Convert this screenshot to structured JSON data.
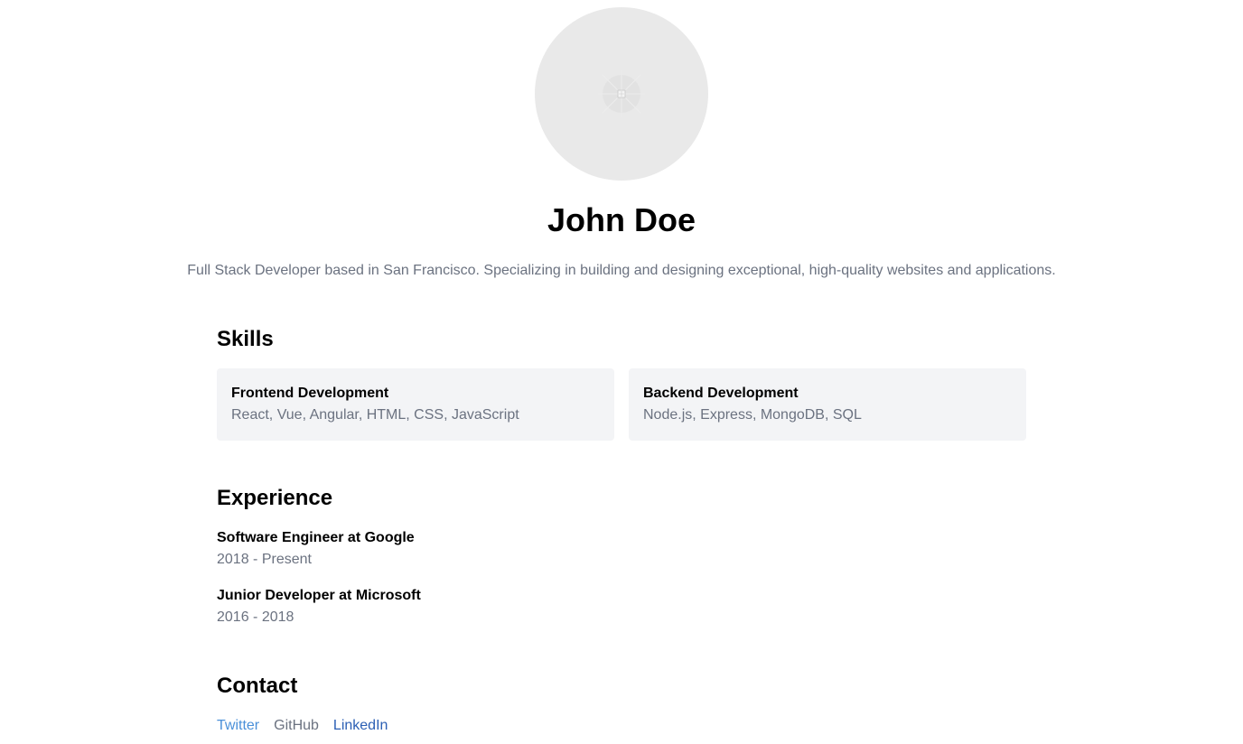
{
  "profile": {
    "name": "John Doe",
    "bio": "Full Stack Developer based in San Francisco. Specializing in building and designing exceptional, high-quality websites and applications.",
    "avatar_icon": "image-placeholder-icon"
  },
  "skills": {
    "heading": "Skills",
    "items": [
      {
        "title": "Frontend Development",
        "description": "React, Vue, Angular, HTML, CSS, JavaScript"
      },
      {
        "title": "Backend Development",
        "description": "Node.js, Express, MongoDB, SQL"
      }
    ]
  },
  "experience": {
    "heading": "Experience",
    "items": [
      {
        "role": "Software Engineer at Google",
        "dates": "2018 - Present"
      },
      {
        "role": "Junior Developer at Microsoft",
        "dates": "2016 - 2018"
      }
    ]
  },
  "contact": {
    "heading": "Contact",
    "links": [
      {
        "label": "Twitter",
        "color": "#4a90d9"
      },
      {
        "label": "GitHub",
        "color": "#6b7280"
      },
      {
        "label": "LinkedIn",
        "color": "#2b5fb4"
      }
    ]
  },
  "colors": {
    "muted_text": "#6b7280",
    "card_background": "#f3f4f6",
    "avatar_background": "#e9e9e9"
  }
}
